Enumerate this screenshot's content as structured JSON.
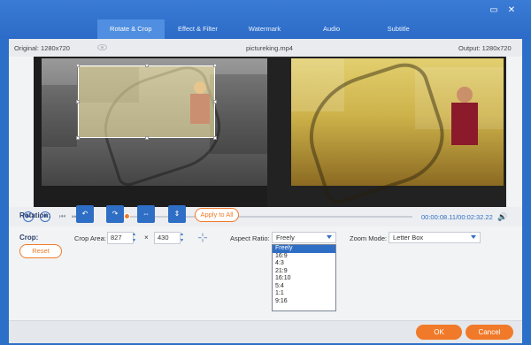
{
  "window": {
    "minimize_icon": "minimize-icon",
    "close_icon": "close-icon",
    "minimize_glyph": "▭",
    "close_glyph": "✕"
  },
  "tabs": [
    {
      "label": "Rotate & Crop",
      "active": true
    },
    {
      "label": "Effect & Filter",
      "active": false
    },
    {
      "label": "Watermark",
      "active": false
    },
    {
      "label": "Audio",
      "active": false
    },
    {
      "label": "Subtitle",
      "active": false
    }
  ],
  "infobar": {
    "original": "Original: 1280x720",
    "filename": "pictureking.mp4",
    "output": "Output: 1280x720"
  },
  "player": {
    "play_glyph": "▶",
    "stop_glyph": "■",
    "prev_glyph": "⏮",
    "next_glyph": "⏭",
    "time": "00:00:08.11/00:02:32.22",
    "volume_glyph": "🔊",
    "progress": 0.06
  },
  "rotation": {
    "label": "Rotation:",
    "buttons": [
      {
        "name": "rotate-left-button",
        "glyph": "↶"
      },
      {
        "name": "rotate-right-button",
        "glyph": "↷"
      },
      {
        "name": "flip-horizontal-button",
        "glyph": "⇔"
      },
      {
        "name": "flip-vertical-button",
        "glyph": "⇕"
      }
    ],
    "apply_all": "Apply to All"
  },
  "crop": {
    "label": "Crop:",
    "area_label": "Crop Area:",
    "width": "827",
    "times": "×",
    "height": "430",
    "crosshair_glyph": "⊹",
    "aspect_label": "Aspect Ratio:",
    "aspect_value": "Freely",
    "zoom_label": "Zoom Mode:",
    "zoom_value": "Letter Box",
    "reset": "Reset",
    "aspect_options": [
      "Freely",
      "16:9",
      "4:3",
      "21:9",
      "16:10",
      "5:4",
      "1:1",
      "9:16"
    ]
  },
  "footer": {
    "ok": "OK",
    "cancel": "Cancel"
  },
  "colors": {
    "accent": "#f07a2a",
    "primary": "#2f6ec5",
    "titlebar": "#2c6cc8"
  }
}
